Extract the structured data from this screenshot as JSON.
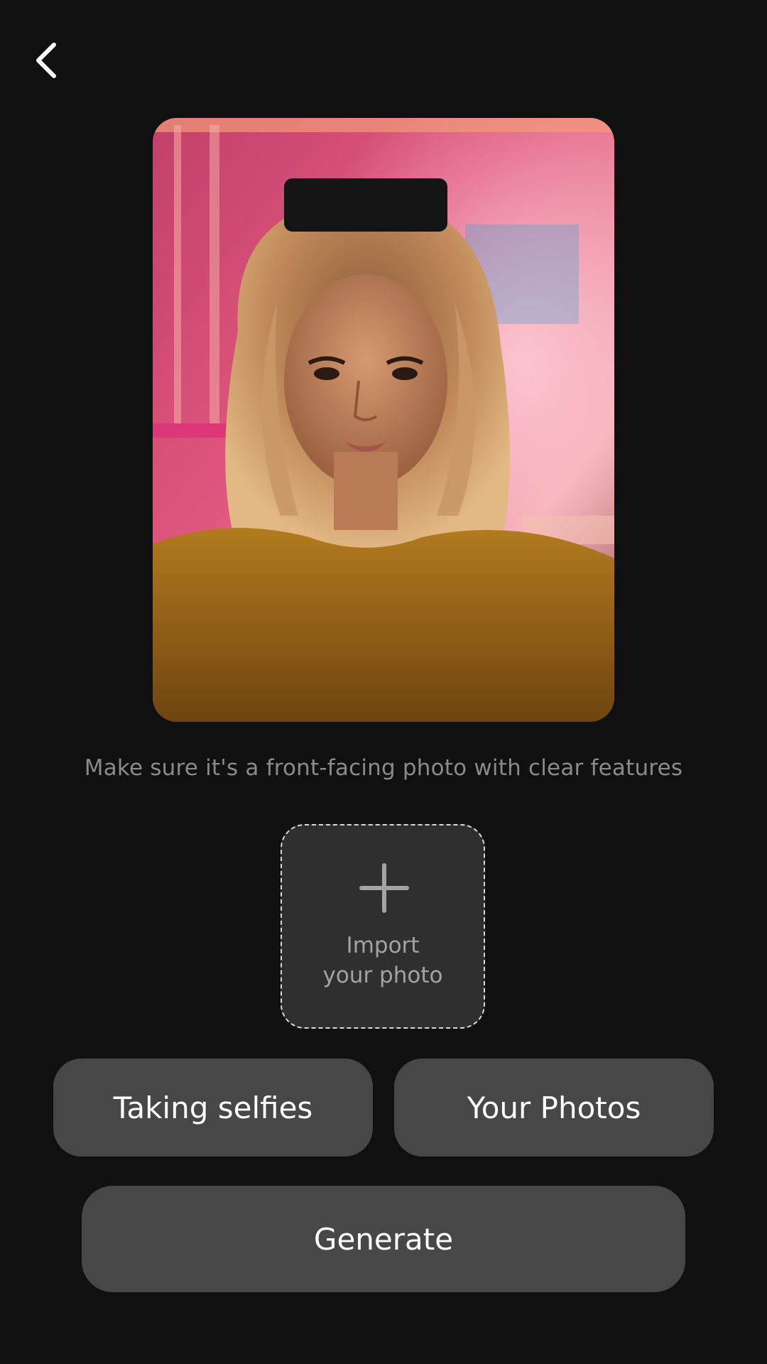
{
  "header": {
    "back_icon": "chevron-left-icon"
  },
  "preview": {
    "image": "portrait of woman with wavy blonde hair in gold sequin top, pink neon background"
  },
  "hint_text": "Make sure it's a front-facing photo with clear features",
  "import": {
    "icon": "plus-icon",
    "line1": "Import",
    "line2": "your photo"
  },
  "actions": {
    "selfie_label": "Taking selfies",
    "photos_label": "Your Photos",
    "generate_label": "Generate"
  },
  "colors": {
    "background": "#101010",
    "button": "#474747",
    "import_box": "#2f2f2f",
    "hint_text": "#8a8a8a"
  }
}
